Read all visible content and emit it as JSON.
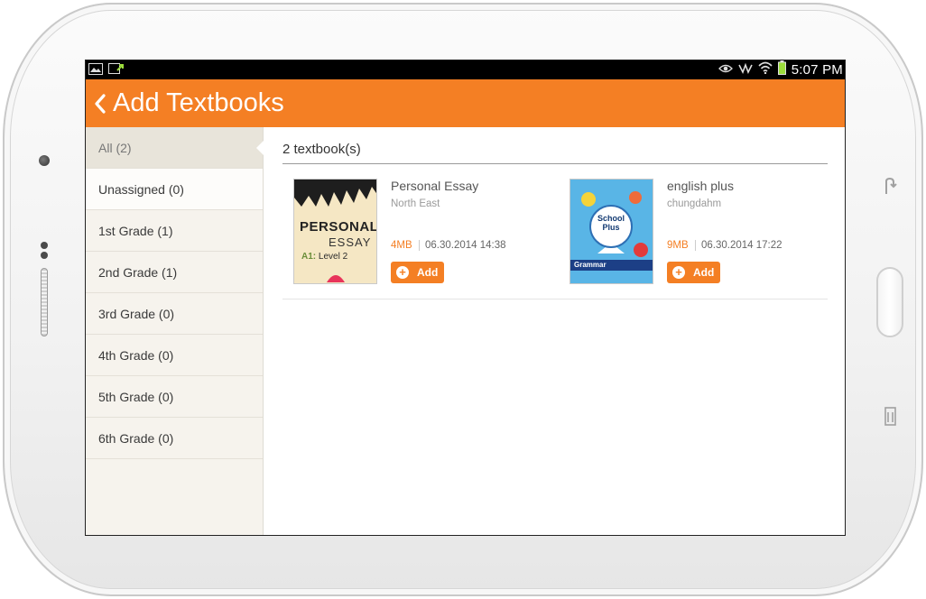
{
  "status_bar": {
    "time": "5:07 PM",
    "left_icons": [
      "image-icon",
      "download-icon"
    ],
    "right_icons": [
      "eye-icon",
      "signal-icon",
      "wifi-icon",
      "battery-icon"
    ]
  },
  "app_bar": {
    "title": "Add Textbooks",
    "back_icon": "chevron-left-icon",
    "color": "#f47f24"
  },
  "sidebar": {
    "items": [
      {
        "label": "All (2)",
        "selected": true
      },
      {
        "label": "Unassigned (0)"
      },
      {
        "label": "1st Grade (1)"
      },
      {
        "label": "2nd Grade (1)"
      },
      {
        "label": "3rd Grade (0)"
      },
      {
        "label": "4th Grade (0)"
      },
      {
        "label": "5th Grade (0)"
      },
      {
        "label": "6th Grade (0)"
      }
    ]
  },
  "main": {
    "count_label": "2 textbook(s)",
    "books": [
      {
        "title": "Personal Essay",
        "publisher": "North East",
        "size": "4MB",
        "date": "06.30.2014 14:38",
        "add_label": "Add",
        "cover": {
          "line1": "PERSONAL",
          "line2": "ESSAY",
          "level_prefix": "A1: ",
          "level": "Level 2"
        }
      },
      {
        "title": "english plus",
        "publisher": "chungdahm",
        "size": "9MB",
        "date": "06.30.2014 17:22",
        "add_label": "Add",
        "cover": {
          "line1": "School",
          "line2": "Plus",
          "band": "Grammar"
        }
      }
    ]
  },
  "accent_color": "#f47f24"
}
